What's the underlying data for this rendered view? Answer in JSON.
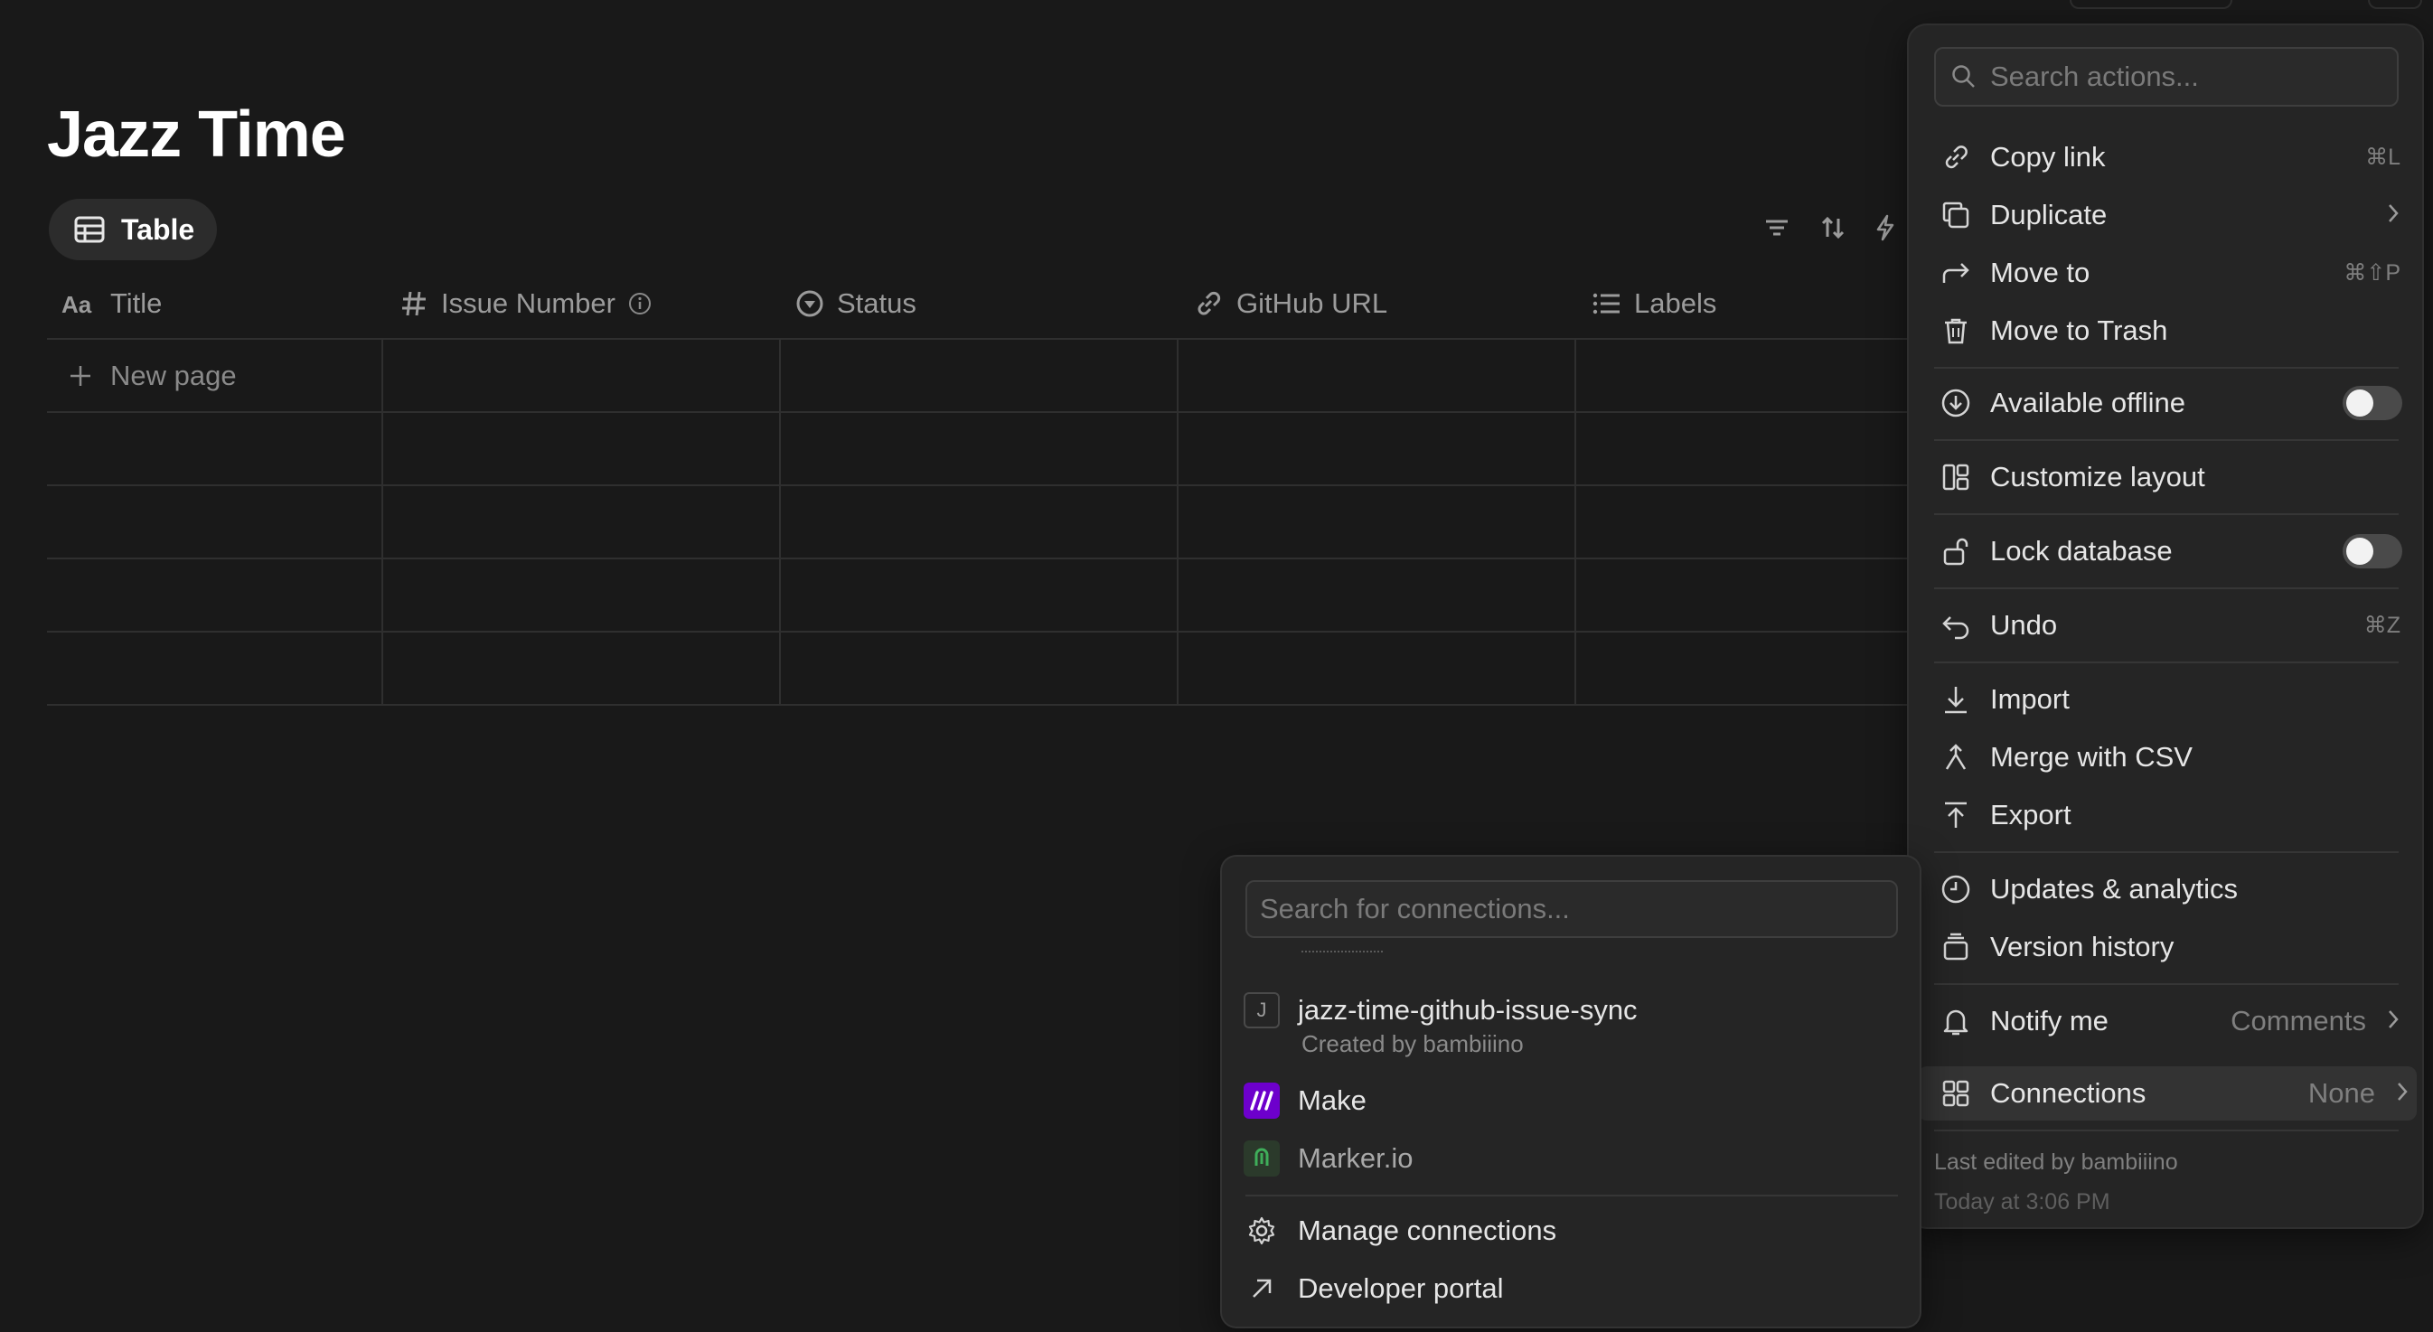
{
  "page": {
    "title": "Jazz Time"
  },
  "view": {
    "tab_label": "Table"
  },
  "table": {
    "columns": [
      {
        "label": "Title",
        "icon": "text-icon"
      },
      {
        "label": "Issue Number",
        "icon": "hash-icon"
      },
      {
        "label": "Status",
        "icon": "status-icon"
      },
      {
        "label": "GitHub URL",
        "icon": "link-icon"
      },
      {
        "label": "Labels",
        "icon": "list-icon"
      }
    ],
    "new_page_label": "New page"
  },
  "actions_menu": {
    "search_placeholder": "Search actions...",
    "copy_link": {
      "label": "Copy link",
      "shortcut": "⌘L"
    },
    "duplicate": {
      "label": "Duplicate"
    },
    "move_to": {
      "label": "Move to",
      "shortcut": "⌘⇧P"
    },
    "move_to_trash": {
      "label": "Move to Trash"
    },
    "available_offline": {
      "label": "Available offline",
      "enabled": false
    },
    "customize_layout": {
      "label": "Customize layout"
    },
    "lock_database": {
      "label": "Lock database",
      "enabled": false
    },
    "undo": {
      "label": "Undo",
      "shortcut": "⌘Z"
    },
    "import": {
      "label": "Import"
    },
    "merge_csv": {
      "label": "Merge with CSV"
    },
    "export": {
      "label": "Export"
    },
    "updates_analytics": {
      "label": "Updates & analytics"
    },
    "version_history": {
      "label": "Version history"
    },
    "notify_me": {
      "label": "Notify me",
      "value": "Comments"
    },
    "connections": {
      "label": "Connections",
      "value": "None"
    },
    "footer": {
      "last_edited": "Last edited by bambiiino",
      "edited_time": "Today at 3:06 PM"
    }
  },
  "connections_menu": {
    "search_placeholder": "Search for connections...",
    "items": [
      {
        "name": "jazz-time-github-issue-sync",
        "subtitle": "Created by bambiiino",
        "badge": "J"
      },
      {
        "name": "Make",
        "badge_color": "#6d00cc"
      },
      {
        "name": "Marker.io",
        "badge_color": "#2b3a2b"
      }
    ],
    "manage_label": "Manage connections",
    "developer_label": "Developer portal"
  }
}
